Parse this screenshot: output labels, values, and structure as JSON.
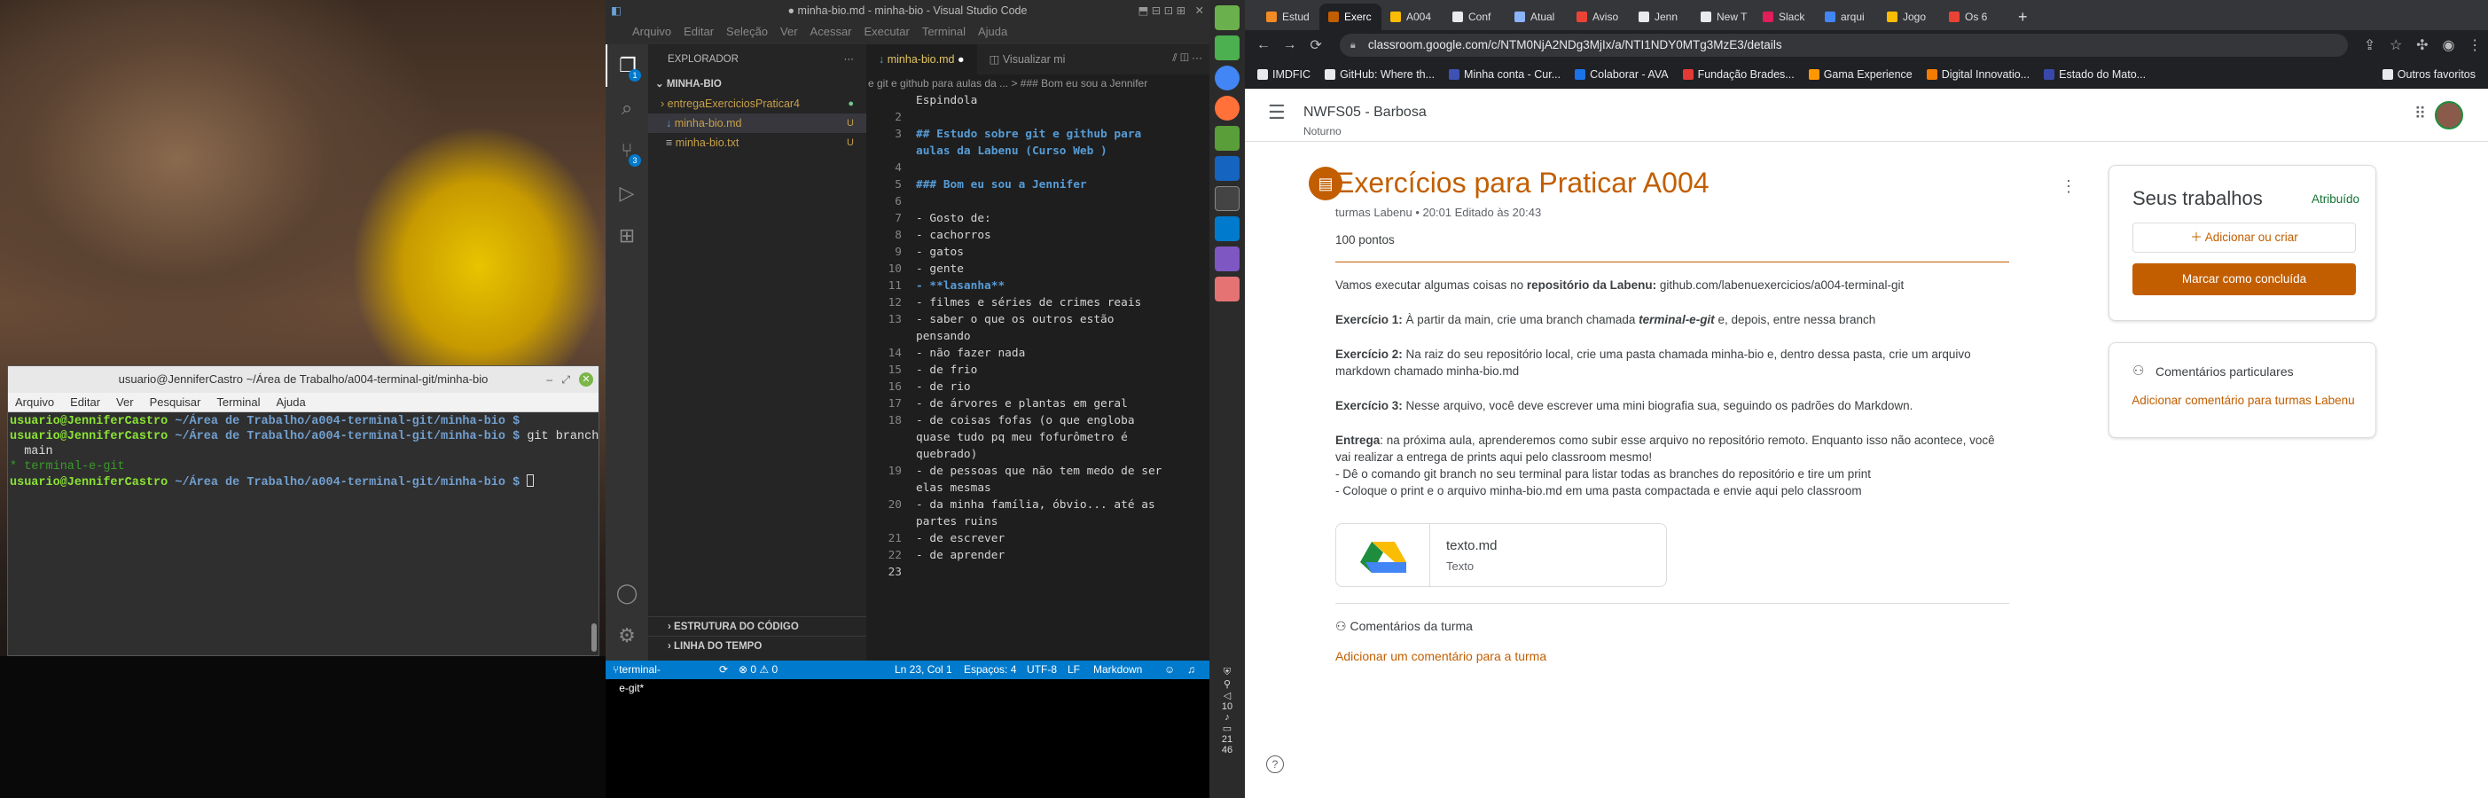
{
  "terminal": {
    "title": "usuario@JenniferCastro ~/Área de Trabalho/a004-terminal-git/minha-bio",
    "menu": [
      "Arquivo",
      "Editar",
      "Ver",
      "Pesquisar",
      "Terminal",
      "Ajuda"
    ],
    "prompt_user": "usuario@JenniferCastro",
    "prompt_path": "~/Área de Trabalho/a004-terminal-git/minha-bio $",
    "cmd1": "git branch",
    "branch_main": "  main",
    "branch_cur": "* terminal-e-git"
  },
  "vscode": {
    "title": "● minha-bio.md - minha-bio - Visual Studio Code",
    "menu": [
      "Arquivo",
      "Editar",
      "Seleção",
      "Ver",
      "Acessar",
      "Executar",
      "Terminal",
      "Ajuda"
    ],
    "explorer_title": "EXPLORADOR",
    "folder": "MINHA-BIO",
    "files": [
      {
        "name": "entregaExerciciosPraticar4",
        "mark": "●"
      },
      {
        "name": "minha-bio.md",
        "mark": "U"
      },
      {
        "name": "minha-bio.txt",
        "mark": "U"
      }
    ],
    "outline": "ESTRUTURA DO CÓDIGO",
    "timeline": "LINHA DO TEMPO",
    "tab_active": "minha-bio.md",
    "tab_other": "Visualizar mi",
    "breadcrumb": "e git e github para aulas da ... > ### Bom eu sou a Jennifer",
    "code": [
      {
        "n": "",
        "t": "Espindola"
      },
      {
        "n": "2",
        "t": ""
      },
      {
        "n": "3",
        "t": "## Estudo sobre git e github para aulas da Labenu (Curso Web )",
        "cls": "h"
      },
      {
        "n": "4",
        "t": ""
      },
      {
        "n": "5",
        "t": "### Bom eu sou a Jennifer",
        "cls": "h"
      },
      {
        "n": "6",
        "t": ""
      },
      {
        "n": "7",
        "t": "- Gosto de:"
      },
      {
        "n": "8",
        "t": "- cachorros"
      },
      {
        "n": "9",
        "t": "- gatos"
      },
      {
        "n": "10",
        "t": "- gente"
      },
      {
        "n": "11",
        "t": "- **lasanha**",
        "cls": "b"
      },
      {
        "n": "12",
        "t": "- filmes e séries de crimes reais"
      },
      {
        "n": "13",
        "t": "- saber o que os outros estão pensando"
      },
      {
        "n": "14",
        "t": "- não fazer nada"
      },
      {
        "n": "15",
        "t": "- de frio"
      },
      {
        "n": "16",
        "t": "- de rio"
      },
      {
        "n": "17",
        "t": "- de árvores e plantas em geral"
      },
      {
        "n": "18",
        "t": "- de coisas fofas (o que engloba quase tudo pq meu fofurômetro é quebrado)"
      },
      {
        "n": "19",
        "t": "- de pessoas que não tem medo de ser elas mesmas"
      },
      {
        "n": "20",
        "t": "- da minha família, óbvio... até as partes ruins"
      },
      {
        "n": "21",
        "t": "- de escrever"
      },
      {
        "n": "22",
        "t": "- de aprender"
      },
      {
        "n": "23",
        "t": "",
        "cur": true
      }
    ],
    "status": {
      "branch": "terminal-e-git*",
      "errors": "⊗ 0 ⚠ 0",
      "pos": "Ln 23, Col 1",
      "spaces": "Espaços: 4",
      "enc": "UTF-8",
      "eol": "LF",
      "lang": "Markdown"
    }
  },
  "panel": {
    "clock_a": "10",
    "clock_b": "21",
    "clock_c": "46"
  },
  "chrome": {
    "tabs": [
      "Estud",
      "Exerc",
      "A004",
      "Conf",
      "Atual",
      "Aviso",
      "Jenn",
      "New T",
      "Slack",
      "arqui",
      "Jogo",
      "Os 6"
    ],
    "tab_icons": [
      "#f28b25",
      "#c25e00",
      "#fbbc04",
      "#e8eaed",
      "#8ab4f8",
      "#ea4335",
      "#e8eaed",
      "#e8eaed",
      "#e01e5a",
      "#4285f4",
      "#fbbc04",
      "#ea4335"
    ],
    "url": "classroom.google.com/c/NTM0NjA2NDg3MjIx/a/NTI1NDY0MTg3MzE3/details",
    "bookmarks": [
      "IMDFIC",
      "GitHub: Where th...",
      "Minha conta - Cur...",
      "Colaborar - AVA",
      "Fundação Brades...",
      "Gama Experience",
      "Digital Innovatio...",
      "Estado do Mato...",
      "Outros favoritos"
    ]
  },
  "classroom": {
    "class_name": "NWFS05 - Barbosa",
    "class_sub": "Noturno",
    "title": "Exercícios para Praticar A004",
    "meta": "turmas Labenu • 20:01 Editado às 20:43",
    "points": "100 pontos",
    "intro_pre": "Vamos executar algumas coisas no ",
    "intro_bold": "repositório da Labenu:",
    "intro_post": " github.com/labenuexercicios/a004-terminal-git",
    "ex1_label": "Exercício 1:",
    "ex1_pre": " À partir da main, crie uma branch chamada ",
    "ex1_em": "terminal-e-git",
    "ex1_post": " e, depois, entre nessa branch",
    "ex2_label": "Exercício 2:",
    "ex2_text": " Na raiz do seu repositório local, crie uma pasta chamada minha-bio e, dentro dessa pasta, crie um arquivo markdown chamado minha-bio.md",
    "ex3_label": "Exercício 3:",
    "ex3_text": " Nesse arquivo, você deve escrever uma mini biografia sua, seguindo os padrões do Markdown.",
    "entrega_label": "Entrega",
    "entrega_text": ": na próxima aula, aprenderemos como subir esse arquivo no repositório remoto. Enquanto isso não acontece, você vai realizar a entrega de prints aqui pelo classroom mesmo!",
    "bullet1": "- Dê o comando git branch no seu terminal para listar todas as branches do repositório e tire um print",
    "bullet2": "- Coloque o print e o arquivo minha-bio.md em uma pasta compactada e envie aqui pelo classroom",
    "attachment_name": "texto.md",
    "attachment_type": "Texto",
    "class_comments": "Comentários da turma",
    "add_class_comment": "Adicionar um comentário para a turma",
    "your_work": "Seus trabalhos",
    "status": "Atribuído",
    "add_create": "Adicionar ou criar",
    "mark_done": "Marcar como concluída",
    "private_comments": "Comentários particulares",
    "add_private": "Adicionar comentário para turmas Labenu"
  }
}
